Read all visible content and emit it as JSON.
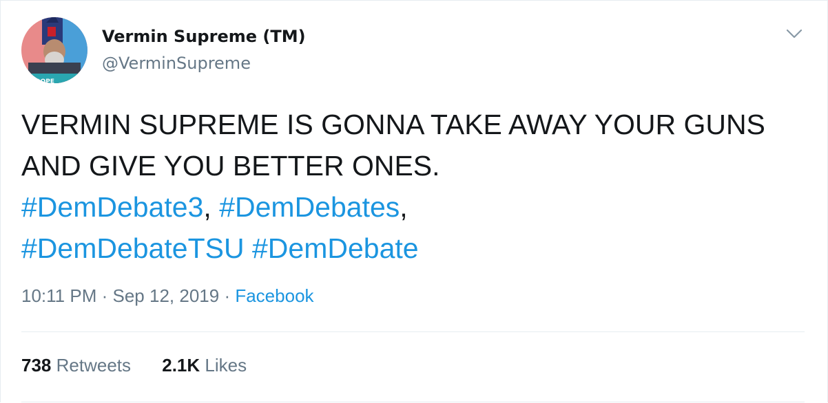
{
  "author": {
    "name": "Vermin Supreme (TM)",
    "handle": "@VerminSupreme"
  },
  "tweet": {
    "line1": "VERMIN SUPREME IS GONNA TAKE AWAY YOUR GUNS",
    "line2": "AND GIVE YOU BETTER ONES.",
    "hashtags": [
      "#DemDebate3",
      "#DemDebates",
      "#DemDebateTSU",
      "#DemDebate"
    ],
    "comma": ","
  },
  "meta": {
    "time": "10:11 PM",
    "separator": "·",
    "date": "Sep 12, 2019",
    "source": "Facebook"
  },
  "stats": {
    "retweets_count": "738",
    "retweets_label": "Retweets",
    "likes_count": "2.1K",
    "likes_label": "Likes"
  },
  "icons": {
    "menu": "chevron-down-icon"
  },
  "colors": {
    "link": "#1b95e0",
    "secondary_text": "#657786",
    "primary_text": "#14171a",
    "divider": "#e6ecf0"
  }
}
